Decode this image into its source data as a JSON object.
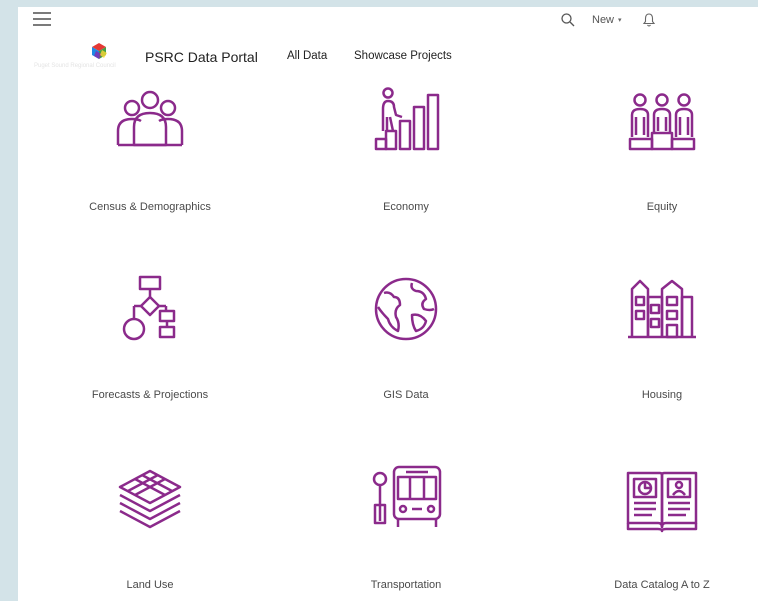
{
  "header": {
    "menu_icon": "hamburger-menu-icon",
    "search_icon": "search-icon",
    "new_label": "New",
    "new_caret": "▾",
    "notifications_icon": "bell-icon",
    "brand_title": "PSRC Data Portal",
    "logo_subtext": "Puget Sound Regional Council",
    "nav": [
      {
        "label": "All Data"
      },
      {
        "label": "Showcase Projects"
      }
    ]
  },
  "accent_color": "#8b2a8b",
  "categories": [
    {
      "label": "Census & Demographics",
      "icon": "people-group-icon"
    },
    {
      "label": "Economy",
      "icon": "person-climbing-bar-chart-icon"
    },
    {
      "label": "Equity",
      "icon": "people-on-podium-icon"
    },
    {
      "label": "Forecasts & Projections",
      "icon": "flowchart-icon"
    },
    {
      "label": "GIS Data",
      "icon": "globe-icon"
    },
    {
      "label": "Housing",
      "icon": "buildings-icon"
    },
    {
      "label": "Land Use",
      "icon": "layers-icon"
    },
    {
      "label": "Transportation",
      "icon": "bus-stop-icon"
    },
    {
      "label": "Data Catalog A to Z",
      "icon": "catalog-book-icon"
    }
  ]
}
